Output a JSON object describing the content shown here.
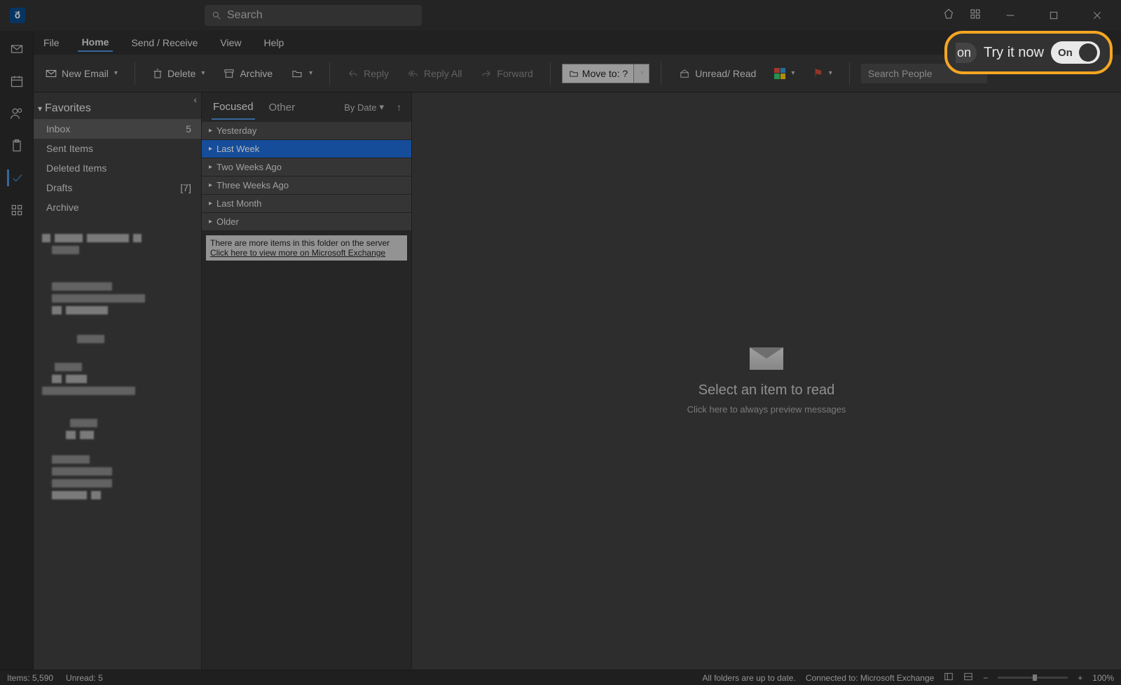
{
  "titlebar": {
    "search_placeholder": "Search"
  },
  "menu": {
    "file": "File",
    "home": "Home",
    "sendreceive": "Send / Receive",
    "view": "View",
    "help": "Help"
  },
  "ribbon": {
    "new_email": "New Email",
    "delete": "Delete",
    "archive": "Archive",
    "reply": "Reply",
    "reply_all": "Reply All",
    "forward": "Forward",
    "move_to": "Move to: ?",
    "unread_read": "Unread/ Read",
    "search_people": "Search People"
  },
  "promo": {
    "partial": "on",
    "label": "Try it now",
    "toggle": "On"
  },
  "folders": {
    "favorites": "Favorites",
    "items": [
      {
        "name": "Inbox",
        "count": "5"
      },
      {
        "name": "Sent Items",
        "count": ""
      },
      {
        "name": "Deleted Items",
        "count": ""
      },
      {
        "name": "Drafts",
        "count": "[7]"
      },
      {
        "name": "Archive",
        "count": ""
      }
    ]
  },
  "msglist": {
    "focused": "Focused",
    "other": "Other",
    "by_date": "By Date",
    "groups": [
      "Yesterday",
      "Last Week",
      "Two Weeks Ago",
      "Three Weeks Ago",
      "Last Month",
      "Older"
    ],
    "more_server": "There are more items in this folder on the server",
    "more_link": "Click here to view more on Microsoft Exchange"
  },
  "reading": {
    "title": "Select an item to read",
    "subtitle": "Click here to always preview messages"
  },
  "status": {
    "items": "Items: 5,590",
    "unread": "Unread: 5",
    "uptodate": "All folders are up to date.",
    "connected": "Connected to: Microsoft Exchange",
    "zoom": "100%"
  }
}
